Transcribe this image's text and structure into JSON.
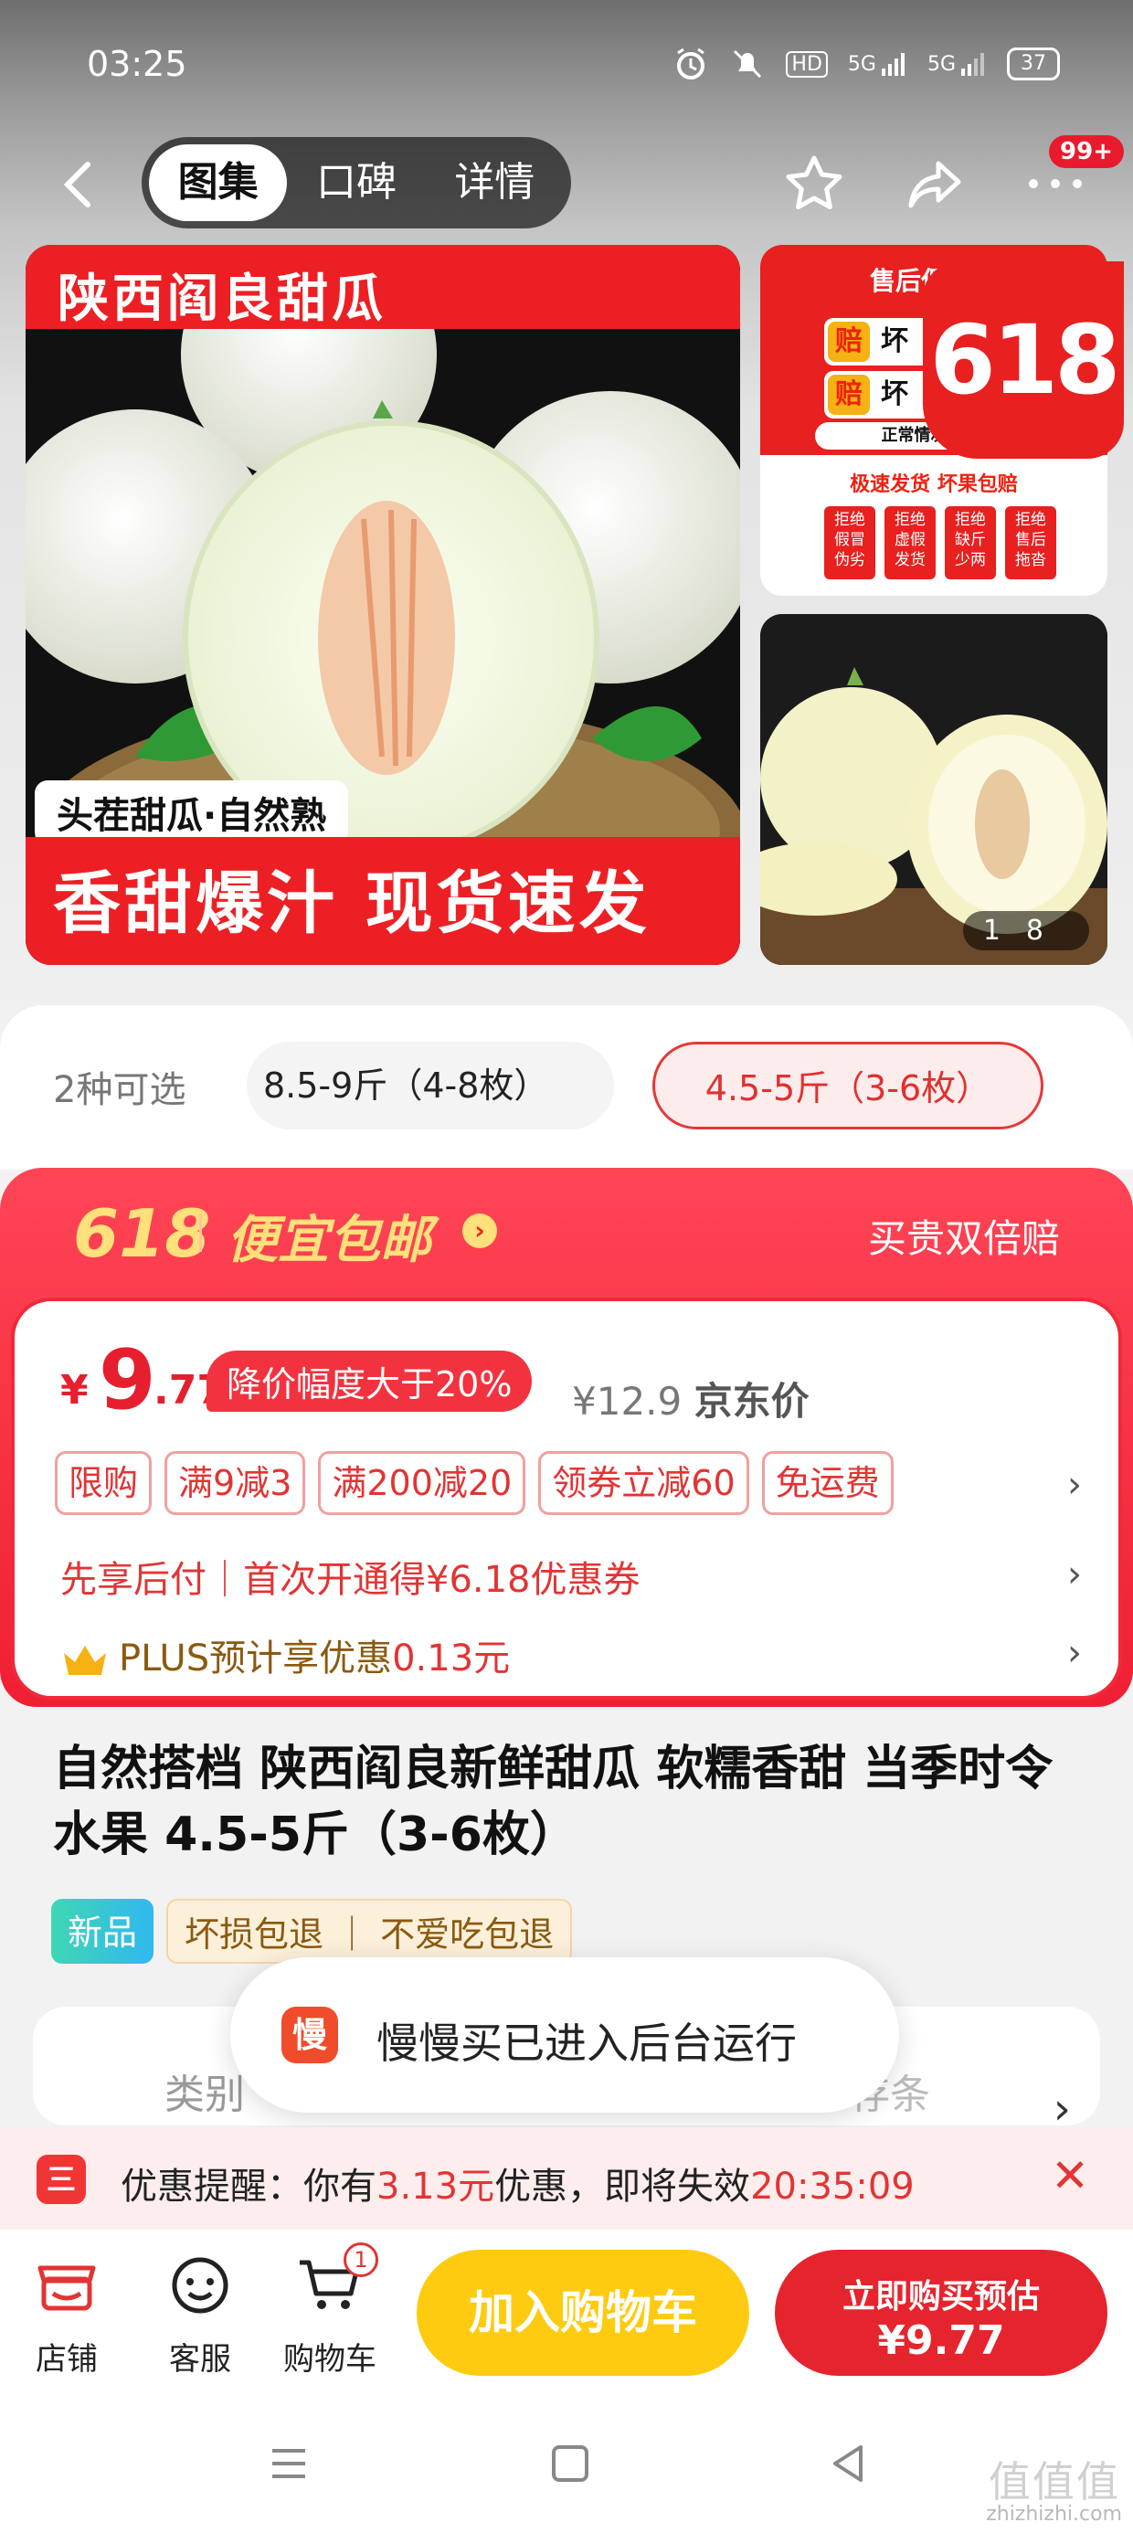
{
  "status_bar": {
    "time": "03:25",
    "icons": [
      "alarm-icon",
      "mute-icon",
      "hd-icon",
      "5g-signal-icon",
      "5g-signal-icon-2"
    ],
    "hd": "HD",
    "net1": "5G",
    "net2": "5G",
    "battery": "37"
  },
  "nav": {
    "tabs": [
      "图集",
      "口碑",
      "详情"
    ],
    "active_tab": "图集",
    "badge": "99+"
  },
  "gallery": {
    "main_title": "陕西阎良甜瓜",
    "main_tag": "头茬甜瓜·自然熟",
    "main_slogan": "香甜爆汁 现货速发",
    "side1": {
      "title": "售后保障说",
      "row1": "坏",
      "row2": "坏",
      "pei": "赔",
      "small": "正常情况24小",
      "red_line": "极速发货 坏果包赔",
      "chips": [
        "拒绝 假冒 伪劣",
        "拒绝 虚假 发货",
        "拒绝 缺斤 少两",
        "拒绝 售后 拖沓"
      ],
      "badge_618": "618"
    },
    "pager_current": "1",
    "pager_total": "8"
  },
  "options": {
    "label": "2种可选",
    "items": [
      "8.5-9斤（4-8枚）",
      "4.5-5斤（3-6枚）"
    ],
    "selected": "4.5-5斤（3-6枚）"
  },
  "promo": {
    "event": "618",
    "cheap_label": "便宜包邮",
    "right_label": "买贵双倍赔",
    "price_yen": "¥",
    "price_int": "9",
    "price_dec": ".77",
    "drop_tag": "降价幅度大于20%",
    "jd_price": "¥12.9",
    "jd_label": "京东价",
    "chips": [
      "限购",
      "满9减3",
      "满200减20",
      "领券立减60",
      "免运费"
    ],
    "line2": "先享后付｜首次开通得¥6.18优惠券",
    "plus_prefix": "PLUS预计享优惠",
    "plus_amount": "0.13元"
  },
  "product": {
    "title": "自然搭档 陕西阎良新鲜甜瓜 软糯香甜 当季时令水果 4.5-5斤（3-6枚）",
    "tag_new": "新品",
    "tag_guarantee": "坏损包退 ｜ 不爱吃包退"
  },
  "hidden_card": {
    "left": "类别",
    "right": "存条"
  },
  "toast": {
    "logo": "慢",
    "text": "慢慢买已进入后台运行"
  },
  "reminder": {
    "logo": "三",
    "prefix": "优惠提醒：你有",
    "amount": "3.13元",
    "middle": "优惠，即将失效",
    "countdown": "20:35:09"
  },
  "bottom_bar": {
    "shop": "店铺",
    "service": "客服",
    "cart": "购物车",
    "cart_count": "1",
    "add_cart": "加入购物车",
    "buy_line1": "立即购买预估",
    "buy_line2": "¥9.77"
  },
  "watermark": {
    "logo": "值值值",
    "url": "zhizhizhi.com"
  }
}
